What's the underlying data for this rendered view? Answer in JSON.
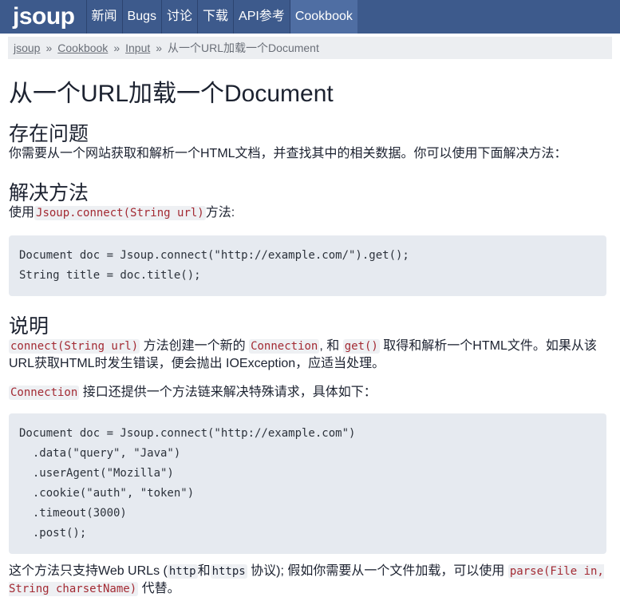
{
  "nav": {
    "logo": "jsoup",
    "items": [
      "新闻",
      "Bugs",
      "讨论",
      "下载",
      "API参考",
      "Cookbook"
    ]
  },
  "breadcrumb": {
    "items": [
      "jsoup",
      "Cookbook",
      "Input"
    ],
    "separator": "»",
    "current": "从一个URL加载一个Document"
  },
  "page": {
    "title": "从一个URL加载一个Document",
    "problem": {
      "heading": "存在问题",
      "text": "你需要从一个网站获取和解析一个HTML文档，并查找其中的相关数据。你可以使用下面解决方法："
    },
    "solution": {
      "heading": "解决方法",
      "pre": "使用",
      "code": "Jsoup.connect(String url)",
      "post": "方法:",
      "block": "Document doc = Jsoup.connect(\"http://example.com/\").get();\nString title = doc.title();"
    },
    "desc": {
      "heading": "说明",
      "p1_code1": "connect(String url)",
      "p1_t1": " 方法创建一个新的 ",
      "p1_code2": "Connection",
      "p1_t2": ", 和 ",
      "p1_code3": "get()",
      "p1_t3": " 取得和解析一个HTML文件。如果从该URL获取HTML时发生错误，便会抛出 IOException，应适当处理。",
      "p2_code": "Connection",
      "p2_text": " 接口还提供一个方法链来解决特殊请求，具体如下：",
      "block": "Document doc = Jsoup.connect(\"http://example.com\")\n  .data(\"query\", \"Java\")\n  .userAgent(\"Mozilla\")\n  .cookie(\"auth\", \"token\")\n  .timeout(3000)\n  .post();",
      "p3_t1": "这个方法只支持Web URLs (",
      "p3_code1": "http",
      "p3_t2": "和",
      "p3_code2": "https",
      "p3_t3": " 协议); 假如你需要从一个文件加载，可以使用 ",
      "p3_code3": "parse(File in, String charsetName)",
      "p3_t4": " 代替。"
    }
  }
}
